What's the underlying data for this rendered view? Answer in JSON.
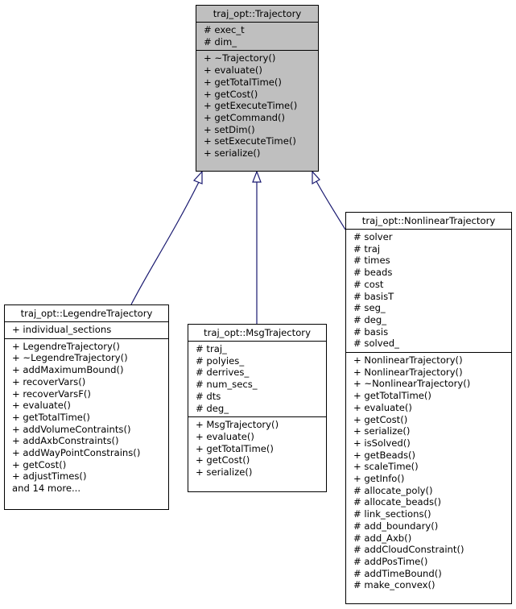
{
  "diagram": {
    "type": "uml-class-inheritance",
    "edge_color": "#191970",
    "base_fill": "#bfbfbf",
    "classes": {
      "trajectory": {
        "name": "traj_opt::Trajectory",
        "attributes": [
          "# exec_t",
          "# dim_"
        ],
        "methods": [
          "+ ~Trajectory()",
          "+ evaluate()",
          "+ getTotalTime()",
          "+ getCost()",
          "+ getExecuteTime()",
          "+ getCommand()",
          "+ setDim()",
          "+ setExecuteTime()",
          "+ serialize()"
        ]
      },
      "legendre": {
        "name": "traj_opt::LegendreTrajectory",
        "attributes": [
          "+ individual_sections"
        ],
        "methods": [
          "+ LegendreTrajectory()",
          "+ ~LegendreTrajectory()",
          "+ addMaximumBound()",
          "+ recoverVars()",
          "+ recoverVarsF()",
          "+ evaluate()",
          "+ getTotalTime()",
          "+ addVolumeContraints()",
          "+ addAxbConstraints()",
          "+ addWayPointConstrains()",
          "+ getCost()",
          "+ adjustTimes()",
          "and 14 more..."
        ]
      },
      "msg": {
        "name": "traj_opt::MsgTrajectory",
        "attributes": [
          "# traj_",
          "# polyies_",
          "# derrives_",
          "# num_secs_",
          "# dts",
          "# deg_"
        ],
        "methods": [
          "+ MsgTrajectory()",
          "+ evaluate()",
          "+ getTotalTime()",
          "+ getCost()",
          "+ serialize()"
        ]
      },
      "nonlinear": {
        "name": "traj_opt::NonlinearTrajectory",
        "attributes": [
          "# solver",
          "# traj",
          "# times",
          "# beads",
          "# cost",
          "# basisT",
          "# seg_",
          "# deg_",
          "# basis",
          "# solved_"
        ],
        "methods": [
          "+ NonlinearTrajectory()",
          "+ NonlinearTrajectory()",
          "+ ~NonlinearTrajectory()",
          "+ getTotalTime()",
          "+ evaluate()",
          "+ getCost()",
          "+ serialize()",
          "+ isSolved()",
          "+ getBeads()",
          "+ scaleTime()",
          "+ getInfo()",
          "# allocate_poly()",
          "# allocate_beads()",
          "# link_sections()",
          "# add_boundary()",
          "# add_Axb()",
          "# addCloudConstraint()",
          "# addPosTime()",
          "# addTimeBound()",
          "# make_convex()"
        ]
      }
    },
    "inheritance": [
      {
        "child": "traj_opt::LegendreTrajectory",
        "parent": "traj_opt::Trajectory"
      },
      {
        "child": "traj_opt::MsgTrajectory",
        "parent": "traj_opt::Trajectory"
      },
      {
        "child": "traj_opt::NonlinearTrajectory",
        "parent": "traj_opt::Trajectory"
      }
    ]
  }
}
